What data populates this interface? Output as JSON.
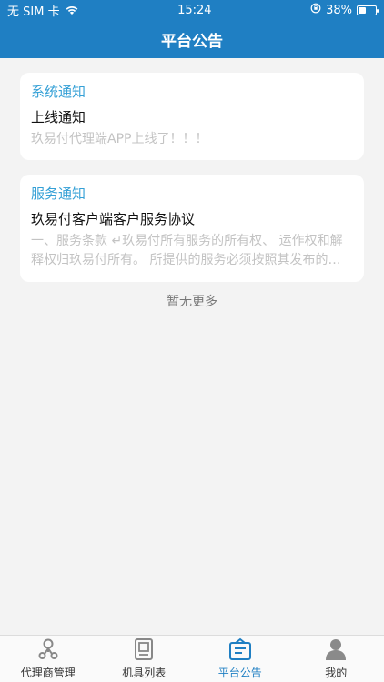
{
  "status": {
    "carrier": "无 SIM 卡",
    "time": "15:24",
    "battery": "38%",
    "battery_level": 0.38
  },
  "header": {
    "title": "平台公告"
  },
  "notices": [
    {
      "category": "系统通知",
      "title": "上线通知",
      "body": "玖易付代理端APP上线了！！！"
    },
    {
      "category": "服务通知",
      "title": "玖易付客户端客户服务协议",
      "body": "一、服务条款 ↵玖易付所有服务的所有权、 运作权和解释权归玖易付所有。 所提供的服务必须按照其发布的服务条款和操作规则严格执行。"
    }
  ],
  "footer_note": "暂无更多",
  "tabs": [
    {
      "label": "代理商管理",
      "icon": "agent-icon",
      "active": false
    },
    {
      "label": "机具列表",
      "icon": "device-icon",
      "active": false
    },
    {
      "label": "平台公告",
      "icon": "announcement-icon",
      "active": true
    },
    {
      "label": "我的",
      "icon": "profile-icon",
      "active": false
    }
  ],
  "colors": {
    "primary": "#1f7fc3",
    "category": "#35a0d6",
    "background": "#f3f3f3"
  }
}
